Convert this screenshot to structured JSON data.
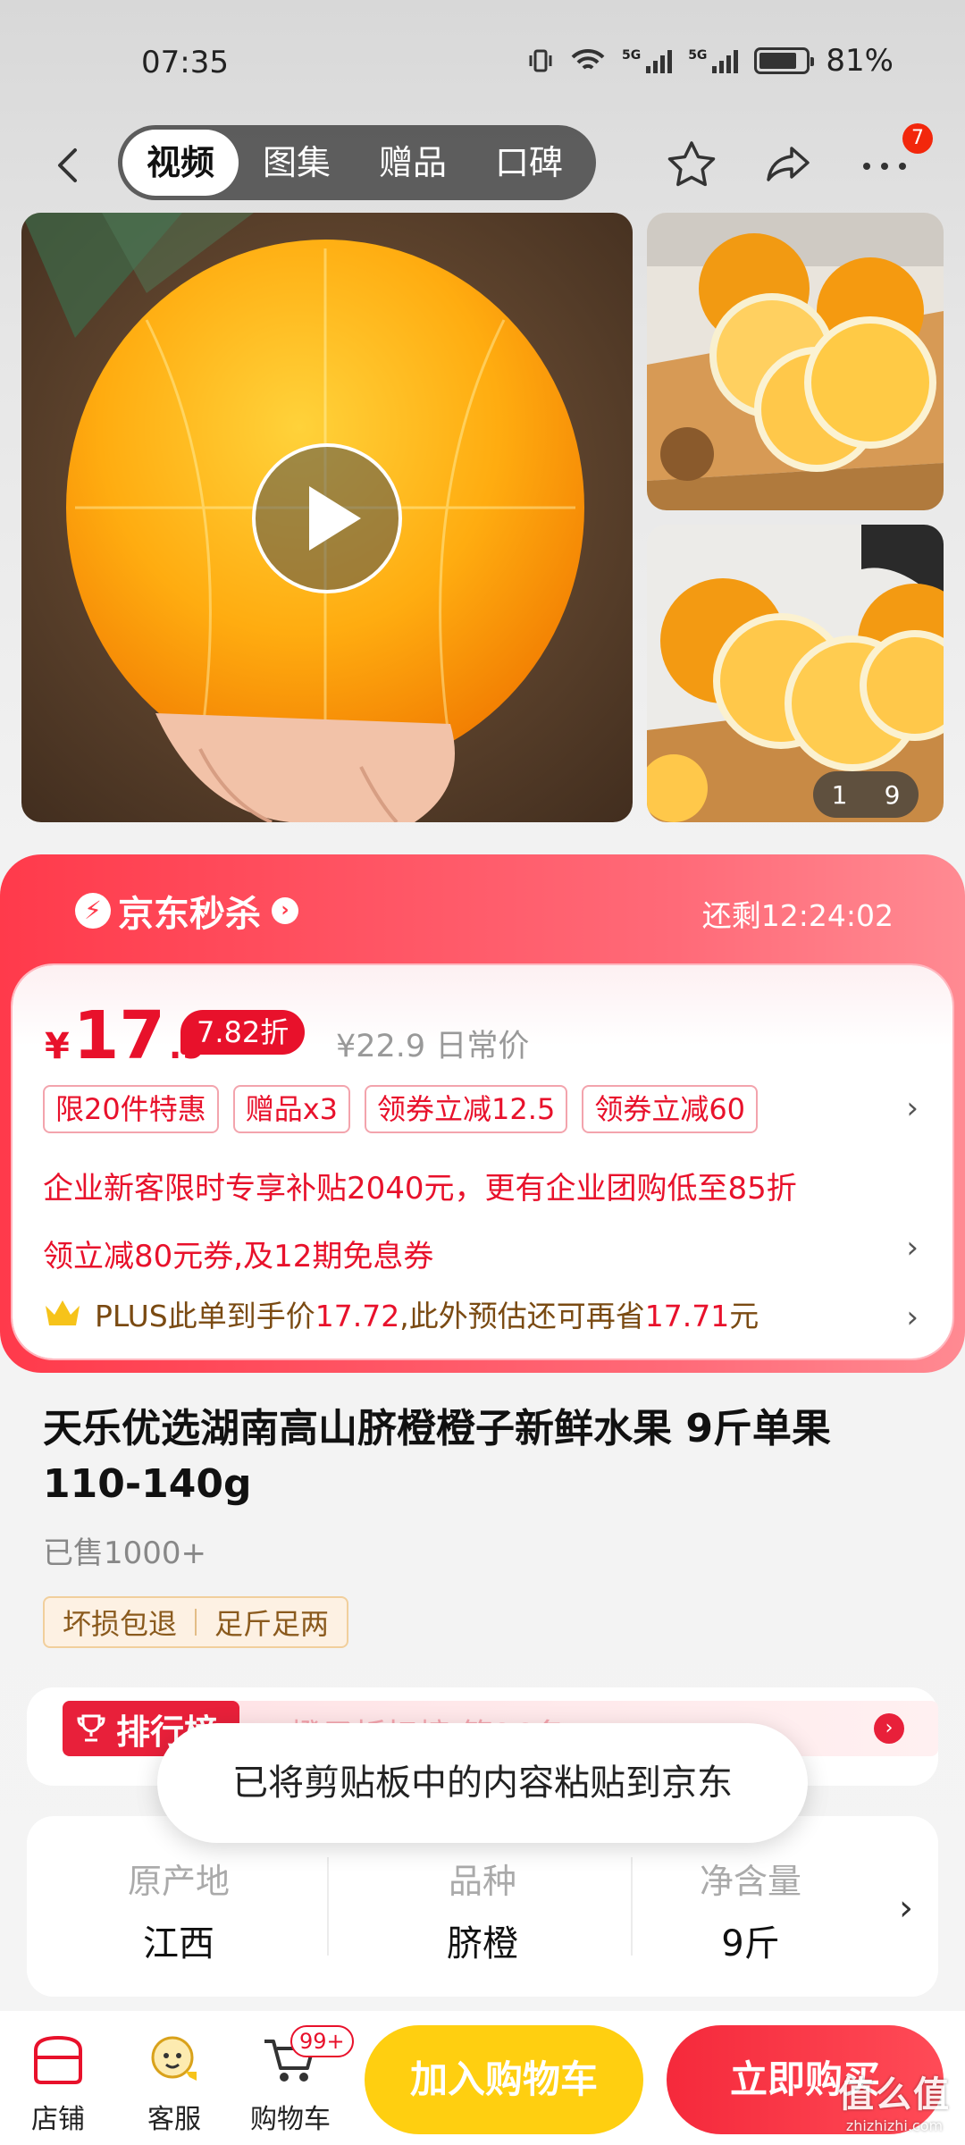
{
  "status": {
    "time": "07:35",
    "battery": "81%",
    "battery_level": 0.81,
    "net1": "5G",
    "net2": "5G"
  },
  "nav": {
    "tabs": [
      {
        "label": "视频"
      },
      {
        "label": "图集"
      },
      {
        "label": "赠品"
      },
      {
        "label": "口碑"
      }
    ],
    "more_badge": "7"
  },
  "gallery": {
    "counter_current": "1",
    "counter_total": "9"
  },
  "seckill": {
    "brand": "京东秒杀",
    "remaining": "还剩12:24:02"
  },
  "price": {
    "currency": "¥",
    "integer": "17",
    "decimal": ".9",
    "discount": "7.82折",
    "original": "¥22.9 日常价"
  },
  "promos": [
    {
      "label": "限20件特惠"
    },
    {
      "label": "赠品x3"
    },
    {
      "label": "领券立减12.5"
    },
    {
      "label": "领券立减60"
    }
  ],
  "enterprise_text": "企业新客限时专享补贴2040元，更有企业团购低至85折",
  "coupon_text": "领立减80元券,及12期免息券",
  "plus": {
    "prefix": "PLUS此单到手价",
    "price": "17.72",
    "middle": ",此外预估还可再省",
    "save": "17.71",
    "suffix": "元"
  },
  "product": {
    "title": "天乐优选湖南高山脐橙橙子新鲜水果 9斤单果110-140g",
    "sold": "已售1000+",
    "guarantees": [
      "坏损包退",
      "足斤足两"
    ]
  },
  "rank": {
    "badge": "排行榜",
    "text": "橙子折扣榜 第26名"
  },
  "toast": "已将剪贴板中的内容粘贴到京东",
  "specs": [
    {
      "label": "原产地",
      "value": "江西"
    },
    {
      "label": "品种",
      "value": "脐橙"
    },
    {
      "label": "净含量",
      "value": "9斤"
    }
  ],
  "bottom": {
    "store": "店铺",
    "service": "客服",
    "cart": "购物车",
    "cart_badge": "99+",
    "add_cart": "加入购物车",
    "buy_now": "立即购买"
  },
  "watermark": {
    "big": "值么值",
    "small": "zhizhizhi.com"
  }
}
